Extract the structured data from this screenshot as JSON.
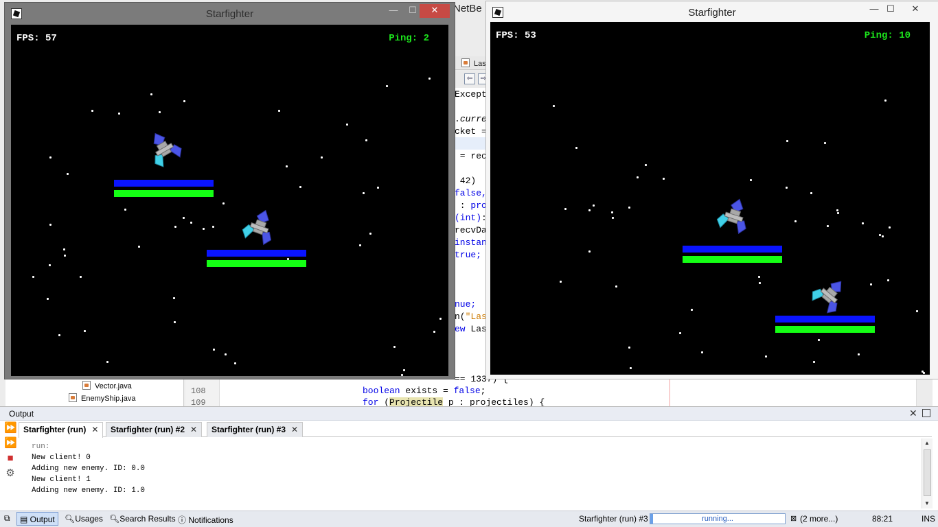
{
  "ide": {
    "title_fragment": "NetBe",
    "tab_fragment": "Las",
    "code_fragments": {
      "l1": "Except",
      "l2a": ".",
      "l2b": "curre",
      "l3": "cket =",
      "l4": " = rec",
      "l5a": " 42) ",
      "l6": "false,",
      "l7a": " : ",
      "l7b": "pro",
      "l8a": "(int)",
      "l8b": ":",
      "l9": "recvDa",
      "l10": "instan",
      "l11": "true;",
      "l12": "nue;",
      "l13a": "n(",
      "l13b": "\"Las",
      "l14a": "ew",
      "l14b": " Las"
    },
    "code_lines": {
      "line107_partial": "== 1337) {",
      "line108_kw": "boolean",
      "line108_rest": " exists = ",
      "line108_kw2": "false",
      "line108_end": ";",
      "line109_kw": "for",
      "line109_a": " (",
      "line109_hl": "Projectile",
      "line109_b": " p : ",
      "line109_c": "projectiles",
      "line109_d": ") {"
    },
    "line_numbers": [
      "108",
      "109"
    ],
    "project_tree": [
      "Vector.java",
      "EnemyShip.java"
    ]
  },
  "windows": [
    {
      "title": "Starfighter",
      "fps": "FPS: 57",
      "ping": "Ping: 2"
    },
    {
      "title": "Starfighter",
      "fps": "FPS: 53",
      "ping": "Ping: 10"
    }
  ],
  "output": {
    "title": "Output",
    "tabs": [
      {
        "label": "Starfighter (run)",
        "close": "✕"
      },
      {
        "label": "Starfighter (run) #2",
        "close": "✕"
      },
      {
        "label": "Starfighter (run) #3",
        "close": "✕"
      }
    ],
    "lines": [
      "run:",
      "New client! 0",
      "Adding new enemy. ID: 0.0",
      "New client! 1",
      "Adding new enemy. ID: 1.0"
    ],
    "close": "✕"
  },
  "status": {
    "buttons": [
      "Output",
      "Usages",
      "Search Results",
      "Notifications"
    ],
    "process": "Starfighter (run) #3",
    "progress_text": "running...",
    "more": "(2 more...)",
    "position": "88:21",
    "mode": "INS"
  },
  "colors": {
    "ping": "#1ce51c",
    "health_blue": "#0a14ff",
    "health_green": "#14ff14",
    "ship_blue": "#4b55e6",
    "ship_cyan": "#40d0e8",
    "ship_gray": "#a8a8a8"
  },
  "icons": [
    "window-app-icon",
    "minimize-icon",
    "maximize-icon",
    "close-icon",
    "rerun-icon",
    "stop-icon",
    "settings-icon",
    "search-icon",
    "info-icon"
  ]
}
